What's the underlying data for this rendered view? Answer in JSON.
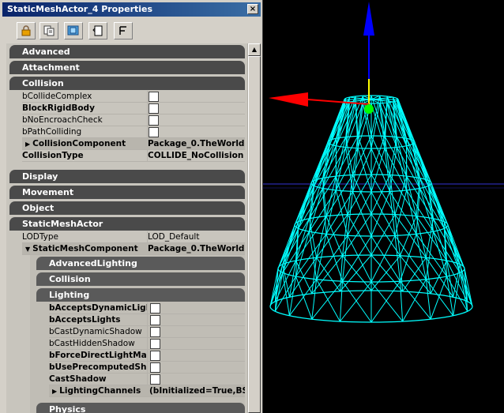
{
  "window": {
    "title": "StaticMeshActor_4 Properties",
    "close": "×"
  },
  "toolbar": {
    "buttons": [
      "lock-icon",
      "copy-icon",
      "view-icon",
      "page-icon",
      "sort-icon"
    ]
  },
  "categories": {
    "advanced": "Advanced",
    "attachment": "Attachment",
    "collision": "Collision",
    "display": "Display",
    "movement": "Movement",
    "object": "Object",
    "staticmeshactor": "StaticMeshActor",
    "advancedlighting": "AdvancedLighting",
    "collision2": "Collision",
    "lighting": "Lighting",
    "physics": "Physics"
  },
  "collision": {
    "bCollideComplex": "bCollideComplex",
    "BlockRigidBody": "BlockRigidBody",
    "bNoEncroachCheck": "bNoEncroachCheck",
    "bPathColliding": "bPathColliding",
    "CollisionComponent": "CollisionComponent",
    "CollisionComponent_val": "Package_0.TheWorld.",
    "CollisionType": "CollisionType",
    "CollisionType_val": "COLLIDE_NoCollision"
  },
  "smactor": {
    "LODType": "LODType",
    "LODType_val": "LOD_Default",
    "StaticMeshComponent": "StaticMeshComponent",
    "StaticMeshComponent_val": "Package_0.TheWorld."
  },
  "lighting": {
    "bAcceptsDynamicLights": "bAcceptsDynamicLigh",
    "bAcceptsLights": "bAcceptsLights",
    "bCastDynamicShadow": "bCastDynamicShadow",
    "bCastHiddenShadow": "bCastHiddenShadow",
    "bForceDirectLightMap": "bForceDirectLightMap",
    "bUsePrecomputedShadows": "bUsePrecomputedSha",
    "CastShadow": "CastShadow",
    "LightingChannels": "LightingChannels",
    "LightingChannels_val": "(bInitialized=True,BS"
  },
  "colors": {
    "wireframe": "#00ffff",
    "axis_z": "#0000ff",
    "axis_x": "#ff0000",
    "pivot": "#00ff00",
    "title_bar": "#0a246a",
    "category_bg": "#4a4a4a"
  }
}
